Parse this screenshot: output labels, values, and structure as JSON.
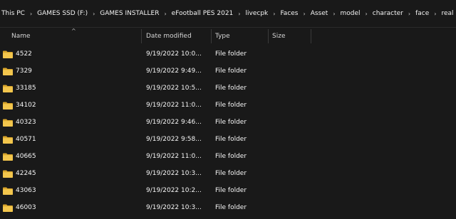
{
  "breadcrumb": {
    "items": [
      "This PC",
      "GAMES SSD (F:)",
      "GAMES INSTALLER",
      "eFootball PES 2021",
      "livecpk",
      "Faces",
      "Asset",
      "model",
      "character",
      "face",
      "real"
    ],
    "separator": "›"
  },
  "columns": {
    "name": "Name",
    "date": "Date modified",
    "type": "Type",
    "size": "Size",
    "sort_indicator": "^"
  },
  "rows": [
    {
      "name": "4522",
      "date": "9/19/2022 10:0...",
      "type": "File folder",
      "size": ""
    },
    {
      "name": "7329",
      "date": "9/19/2022 9:49...",
      "type": "File folder",
      "size": ""
    },
    {
      "name": "33185",
      "date": "9/19/2022 10:5...",
      "type": "File folder",
      "size": ""
    },
    {
      "name": "34102",
      "date": "9/19/2022 11:0...",
      "type": "File folder",
      "size": ""
    },
    {
      "name": "40323",
      "date": "9/19/2022 9:46...",
      "type": "File folder",
      "size": ""
    },
    {
      "name": "40571",
      "date": "9/19/2022 9:58...",
      "type": "File folder",
      "size": ""
    },
    {
      "name": "40665",
      "date": "9/19/2022 11:0...",
      "type": "File folder",
      "size": ""
    },
    {
      "name": "42245",
      "date": "9/19/2022 10:3...",
      "type": "File folder",
      "size": ""
    },
    {
      "name": "43063",
      "date": "9/19/2022 10:2...",
      "type": "File folder",
      "size": ""
    },
    {
      "name": "46003",
      "date": "9/19/2022 10:3...",
      "type": "File folder",
      "size": ""
    }
  ],
  "icons": {
    "folder": "folder-icon"
  },
  "colors": {
    "background": "#191919",
    "folder": "#f3c64d",
    "folder_dark": "#d9a52c"
  }
}
